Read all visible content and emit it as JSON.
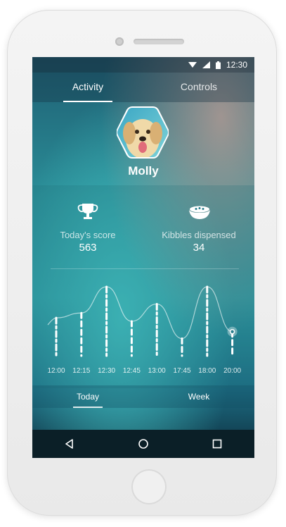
{
  "status_bar": {
    "time": "12:30",
    "icons": [
      "wifi-icon",
      "signal-icon",
      "battery-icon"
    ]
  },
  "tabs": [
    {
      "label": "Activity",
      "active": true
    },
    {
      "label": "Controls",
      "active": false
    }
  ],
  "pet": {
    "name": "Molly"
  },
  "stats": {
    "score": {
      "label": "Today's score",
      "value": "563",
      "icon": "trophy-icon"
    },
    "kibbles": {
      "label": "Kibbles dispensed",
      "value": "34",
      "icon": "food-bowl-icon"
    }
  },
  "chart_data": {
    "type": "line",
    "categories": [
      "12:00",
      "12:15",
      "12:30",
      "12:45",
      "13:00",
      "17:45",
      "18:00",
      "20:00"
    ],
    "values": [
      0.55,
      0.62,
      1.0,
      0.5,
      0.75,
      0.25,
      1.0,
      0.35
    ],
    "selected_index": 7
  },
  "periods": [
    {
      "label": "Today",
      "active": true
    },
    {
      "label": "Week",
      "active": false
    }
  ],
  "nav": [
    "back-icon",
    "home-icon",
    "recents-icon"
  ]
}
